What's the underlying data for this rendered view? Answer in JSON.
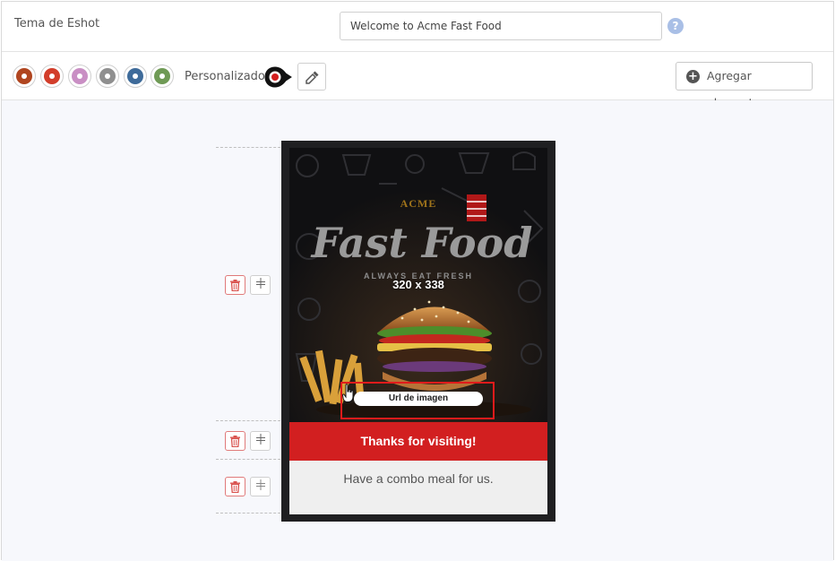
{
  "theme": {
    "label": "Tema de Eshot",
    "input_value": "Welcome to Acme Fast Food",
    "help": "?"
  },
  "colors": {
    "swatches": [
      "#b0451f",
      "#d23d2a",
      "#c98fc4",
      "#8f8f8f",
      "#3e6b9a",
      "#6f9a55"
    ],
    "custom_label": "Personalizado",
    "custom_color": "#d21f20",
    "add_label": "Agregar elementos"
  },
  "email": {
    "hero": {
      "brand_small": "ACME",
      "brand_large": "Fast Food",
      "tagline": "ALWAYS EAT FRESH",
      "dimensions": "320 x 338",
      "url_button": "Url de imagen"
    },
    "banner_text": "Thanks for visiting!",
    "body_text": "Have a combo meal for us."
  }
}
